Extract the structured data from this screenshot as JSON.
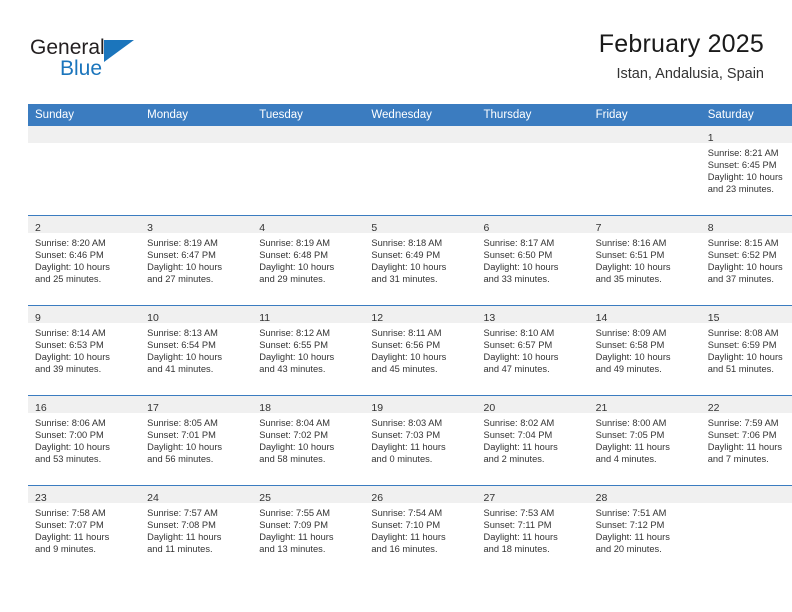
{
  "brand": {
    "name_part1": "General",
    "name_part2": "Blue",
    "flag_icon": "triangle-flag-icon"
  },
  "header": {
    "title": "February 2025",
    "subtitle": "Istan, Andalusia, Spain"
  },
  "colors": {
    "header_blue": "#3b7cc0",
    "brand_blue": "#1b75bc",
    "daynum_band": "#f0f0f0",
    "text": "#333333"
  },
  "weekday_headers": [
    "Sunday",
    "Monday",
    "Tuesday",
    "Wednesday",
    "Thursday",
    "Friday",
    "Saturday"
  ],
  "labels": {
    "sunrise_prefix": "Sunrise:",
    "sunset_prefix": "Sunset:",
    "daylight_prefix": "Daylight:"
  },
  "weeks": [
    [
      {
        "empty": true
      },
      {
        "empty": true
      },
      {
        "empty": true
      },
      {
        "empty": true
      },
      {
        "empty": true
      },
      {
        "empty": true
      },
      {
        "empty": false,
        "day": "1",
        "sunrise": "Sunrise: 8:21 AM",
        "sunset": "Sunset: 6:45 PM",
        "daylight_line1": "Daylight: 10 hours",
        "daylight_line2": "and 23 minutes."
      }
    ],
    [
      {
        "empty": false,
        "day": "2",
        "sunrise": "Sunrise: 8:20 AM",
        "sunset": "Sunset: 6:46 PM",
        "daylight_line1": "Daylight: 10 hours",
        "daylight_line2": "and 25 minutes."
      },
      {
        "empty": false,
        "day": "3",
        "sunrise": "Sunrise: 8:19 AM",
        "sunset": "Sunset: 6:47 PM",
        "daylight_line1": "Daylight: 10 hours",
        "daylight_line2": "and 27 minutes."
      },
      {
        "empty": false,
        "day": "4",
        "sunrise": "Sunrise: 8:19 AM",
        "sunset": "Sunset: 6:48 PM",
        "daylight_line1": "Daylight: 10 hours",
        "daylight_line2": "and 29 minutes."
      },
      {
        "empty": false,
        "day": "5",
        "sunrise": "Sunrise: 8:18 AM",
        "sunset": "Sunset: 6:49 PM",
        "daylight_line1": "Daylight: 10 hours",
        "daylight_line2": "and 31 minutes."
      },
      {
        "empty": false,
        "day": "6",
        "sunrise": "Sunrise: 8:17 AM",
        "sunset": "Sunset: 6:50 PM",
        "daylight_line1": "Daylight: 10 hours",
        "daylight_line2": "and 33 minutes."
      },
      {
        "empty": false,
        "day": "7",
        "sunrise": "Sunrise: 8:16 AM",
        "sunset": "Sunset: 6:51 PM",
        "daylight_line1": "Daylight: 10 hours",
        "daylight_line2": "and 35 minutes."
      },
      {
        "empty": false,
        "day": "8",
        "sunrise": "Sunrise: 8:15 AM",
        "sunset": "Sunset: 6:52 PM",
        "daylight_line1": "Daylight: 10 hours",
        "daylight_line2": "and 37 minutes."
      }
    ],
    [
      {
        "empty": false,
        "day": "9",
        "sunrise": "Sunrise: 8:14 AM",
        "sunset": "Sunset: 6:53 PM",
        "daylight_line1": "Daylight: 10 hours",
        "daylight_line2": "and 39 minutes."
      },
      {
        "empty": false,
        "day": "10",
        "sunrise": "Sunrise: 8:13 AM",
        "sunset": "Sunset: 6:54 PM",
        "daylight_line1": "Daylight: 10 hours",
        "daylight_line2": "and 41 minutes."
      },
      {
        "empty": false,
        "day": "11",
        "sunrise": "Sunrise: 8:12 AM",
        "sunset": "Sunset: 6:55 PM",
        "daylight_line1": "Daylight: 10 hours",
        "daylight_line2": "and 43 minutes."
      },
      {
        "empty": false,
        "day": "12",
        "sunrise": "Sunrise: 8:11 AM",
        "sunset": "Sunset: 6:56 PM",
        "daylight_line1": "Daylight: 10 hours",
        "daylight_line2": "and 45 minutes."
      },
      {
        "empty": false,
        "day": "13",
        "sunrise": "Sunrise: 8:10 AM",
        "sunset": "Sunset: 6:57 PM",
        "daylight_line1": "Daylight: 10 hours",
        "daylight_line2": "and 47 minutes."
      },
      {
        "empty": false,
        "day": "14",
        "sunrise": "Sunrise: 8:09 AM",
        "sunset": "Sunset: 6:58 PM",
        "daylight_line1": "Daylight: 10 hours",
        "daylight_line2": "and 49 minutes."
      },
      {
        "empty": false,
        "day": "15",
        "sunrise": "Sunrise: 8:08 AM",
        "sunset": "Sunset: 6:59 PM",
        "daylight_line1": "Daylight: 10 hours",
        "daylight_line2": "and 51 minutes."
      }
    ],
    [
      {
        "empty": false,
        "day": "16",
        "sunrise": "Sunrise: 8:06 AM",
        "sunset": "Sunset: 7:00 PM",
        "daylight_line1": "Daylight: 10 hours",
        "daylight_line2": "and 53 minutes."
      },
      {
        "empty": false,
        "day": "17",
        "sunrise": "Sunrise: 8:05 AM",
        "sunset": "Sunset: 7:01 PM",
        "daylight_line1": "Daylight: 10 hours",
        "daylight_line2": "and 56 minutes."
      },
      {
        "empty": false,
        "day": "18",
        "sunrise": "Sunrise: 8:04 AM",
        "sunset": "Sunset: 7:02 PM",
        "daylight_line1": "Daylight: 10 hours",
        "daylight_line2": "and 58 minutes."
      },
      {
        "empty": false,
        "day": "19",
        "sunrise": "Sunrise: 8:03 AM",
        "sunset": "Sunset: 7:03 PM",
        "daylight_line1": "Daylight: 11 hours",
        "daylight_line2": "and 0 minutes."
      },
      {
        "empty": false,
        "day": "20",
        "sunrise": "Sunrise: 8:02 AM",
        "sunset": "Sunset: 7:04 PM",
        "daylight_line1": "Daylight: 11 hours",
        "daylight_line2": "and 2 minutes."
      },
      {
        "empty": false,
        "day": "21",
        "sunrise": "Sunrise: 8:00 AM",
        "sunset": "Sunset: 7:05 PM",
        "daylight_line1": "Daylight: 11 hours",
        "daylight_line2": "and 4 minutes."
      },
      {
        "empty": false,
        "day": "22",
        "sunrise": "Sunrise: 7:59 AM",
        "sunset": "Sunset: 7:06 PM",
        "daylight_line1": "Daylight: 11 hours",
        "daylight_line2": "and 7 minutes."
      }
    ],
    [
      {
        "empty": false,
        "day": "23",
        "sunrise": "Sunrise: 7:58 AM",
        "sunset": "Sunset: 7:07 PM",
        "daylight_line1": "Daylight: 11 hours",
        "daylight_line2": "and 9 minutes."
      },
      {
        "empty": false,
        "day": "24",
        "sunrise": "Sunrise: 7:57 AM",
        "sunset": "Sunset: 7:08 PM",
        "daylight_line1": "Daylight: 11 hours",
        "daylight_line2": "and 11 minutes."
      },
      {
        "empty": false,
        "day": "25",
        "sunrise": "Sunrise: 7:55 AM",
        "sunset": "Sunset: 7:09 PM",
        "daylight_line1": "Daylight: 11 hours",
        "daylight_line2": "and 13 minutes."
      },
      {
        "empty": false,
        "day": "26",
        "sunrise": "Sunrise: 7:54 AM",
        "sunset": "Sunset: 7:10 PM",
        "daylight_line1": "Daylight: 11 hours",
        "daylight_line2": "and 16 minutes."
      },
      {
        "empty": false,
        "day": "27",
        "sunrise": "Sunrise: 7:53 AM",
        "sunset": "Sunset: 7:11 PM",
        "daylight_line1": "Daylight: 11 hours",
        "daylight_line2": "and 18 minutes."
      },
      {
        "empty": false,
        "day": "28",
        "sunrise": "Sunrise: 7:51 AM",
        "sunset": "Sunset: 7:12 PM",
        "daylight_line1": "Daylight: 11 hours",
        "daylight_line2": "and 20 minutes."
      },
      {
        "empty": true
      }
    ]
  ]
}
